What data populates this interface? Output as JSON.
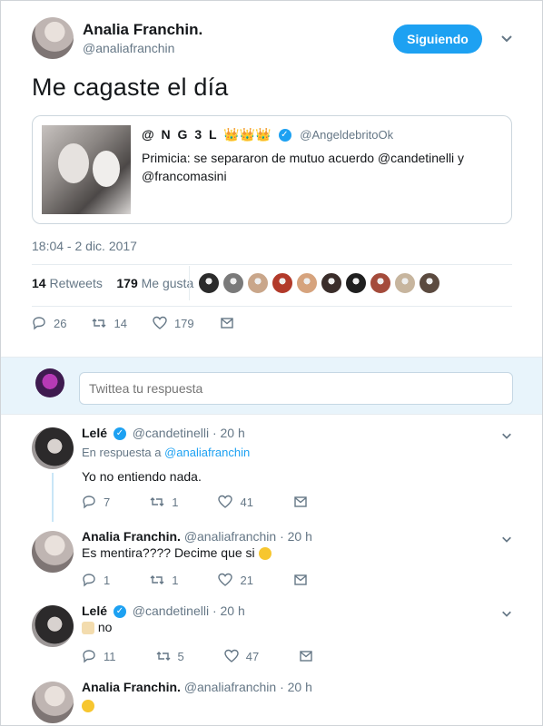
{
  "main_tweet": {
    "author_name": "Analia Franchin.",
    "author_handle": "@analiafranchin",
    "follow_label": "Siguiendo",
    "text": "Me cagaste el día",
    "quoted": {
      "name_prefix": "@ N G 3 L",
      "name_emojis": "👑👑👑",
      "handle": "@AngeldebritoOk",
      "text": "Primicia: se separaron de mutuo acuerdo @candetinelli y @francomasini"
    },
    "timestamp": "18:04 - 2 dic. 2017",
    "retweets_count": "14",
    "retweets_label": "Retweets",
    "likes_count": "179",
    "likes_label": "Me gusta",
    "likers_count": 10,
    "actions": {
      "replies": "26",
      "retweets": "14",
      "likes": "179"
    }
  },
  "reply_box": {
    "placeholder": "Twittea tu respuesta"
  },
  "replies": [
    {
      "name": "Lelé",
      "handle": "@candetinelli",
      "time": "· 20 h",
      "in_reply_label": "En respuesta a",
      "in_reply_handle": "@analiafranchin",
      "text": "Yo no entiendo nada.",
      "replies": "7",
      "retweets": "1",
      "likes": "41"
    },
    {
      "name": "Analia Franchin.",
      "handle": "@analiafranchin",
      "time": "· 20 h",
      "text": "Es mentira???? Decime que si",
      "replies": "1",
      "retweets": "1",
      "likes": "21"
    },
    {
      "name": "Lelé",
      "handle": "@candetinelli",
      "time": "· 20 h",
      "text": "no",
      "replies": "11",
      "retweets": "5",
      "likes": "47"
    },
    {
      "name": "Analia Franchin.",
      "handle": "@analiafranchin",
      "time": "· 20 h",
      "text": ""
    }
  ],
  "colors": {
    "accent": "#1da1f2",
    "muted": "#657786",
    "band": "#e8f4fb"
  }
}
